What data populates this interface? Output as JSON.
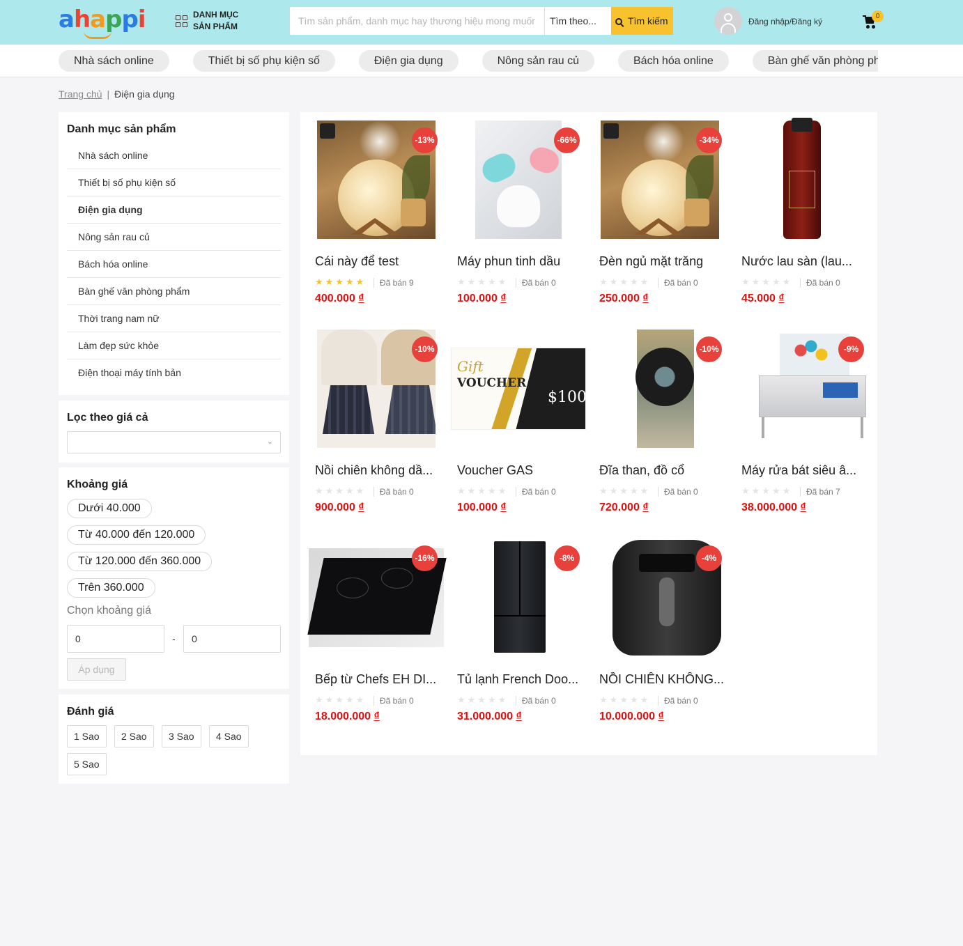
{
  "header": {
    "logo": [
      "a",
      "h",
      "a",
      "p",
      "p",
      "i"
    ],
    "logo_colors": [
      "#2a7be4",
      "#e94335",
      "#f29a1f",
      "#3aa655",
      "#2a7be4",
      "#e94335"
    ],
    "category_button": "DANH MỤC SẢN PHẨM",
    "search_placeholder": "Tìm sản phẩm, danh mục hay thương hiệu mong muốn",
    "search_scope": "Tìm theo...",
    "search_button": "Tìm kiếm",
    "login": "Đăng nhập/Đăng ký",
    "cart_count": "0"
  },
  "catnav": [
    "Nhà sách online",
    "Thiết bị số phụ kiện số",
    "Điện gia dụng",
    "Nông sản rau củ",
    "Bách hóa online",
    "Bàn ghế văn phòng phẩm"
  ],
  "breadcrumb": {
    "home": "Trang chủ",
    "sep": "|",
    "current": "Điện gia dụng"
  },
  "sidebar": {
    "categories_title": "Danh mục sản phẩm",
    "categories": [
      "Nhà sách online",
      "Thiết bị số phụ kiện số",
      "Điện gia dụng",
      "Nông sản rau củ",
      "Bách hóa online",
      "Bàn ghế văn phòng phẩm",
      "Thời trang nam nữ",
      "Làm đẹp sức khỏe",
      "Điện thoại máy tính bản"
    ],
    "active_category": 2,
    "price_filter_title": "Lọc theo giá cả",
    "range_title": "Khoảng giá",
    "ranges": [
      "Dưới 40.000",
      "Từ 40.000 đến 120.000",
      "Từ 120.000 đến 360.000",
      "Trên 360.000"
    ],
    "choose_range": "Chọn khoảng giá",
    "min": "0",
    "dash": "-",
    "max": "0",
    "apply": "Áp dụng",
    "rating_title": "Đánh giá",
    "ratings": [
      "1 Sao",
      "2 Sao",
      "3 Sao",
      "4 Sao",
      "5 Sao"
    ]
  },
  "products": [
    {
      "name": "Cái này để test",
      "discount": "-13%",
      "rating": 5,
      "sold": "Đã bán 9",
      "price": "400.000",
      "currency": "₫",
      "image": "moon-lamp"
    },
    {
      "name": "Máy phun tinh dầu",
      "discount": "-66%",
      "rating": 0,
      "sold": "Đã bán 0",
      "price": "100.000",
      "currency": "₫",
      "image": "mist-diffuser"
    },
    {
      "name": "Đèn ngủ mặt trăng",
      "discount": "-34%",
      "rating": 0,
      "sold": "Đã bán 0",
      "price": "250.000",
      "currency": "₫",
      "image": "moon-lamp"
    },
    {
      "name": "Nước lau sàn (lau...",
      "discount": "",
      "rating": 0,
      "sold": "Đã bán 0",
      "price": "45.000",
      "currency": "₫",
      "image": "cleaner-bottle"
    },
    {
      "name": "Nồi chiên không dầ...",
      "discount": "-10%",
      "rating": 0,
      "sold": "Đã bán 0",
      "price": "900.000",
      "currency": "₫",
      "image": "skirts"
    },
    {
      "name": "Voucher GAS",
      "discount": "",
      "rating": 0,
      "sold": "Đã bán 0",
      "price": "100.000",
      "currency": "₫",
      "image": "voucher",
      "voucher_text": [
        "Gift",
        "VOUCHER",
        "$100"
      ]
    },
    {
      "name": "Đĩa than, đồ cổ",
      "discount": "-10%",
      "rating": 0,
      "sold": "Đã bán 0",
      "price": "720.000",
      "currency": "₫",
      "image": "vinyl"
    },
    {
      "name": "Máy rửa bát siêu â...",
      "discount": "-9%",
      "rating": 0,
      "sold": "Đã bán 7",
      "price": "38.000.000",
      "currency": "₫",
      "image": "dishwasher"
    },
    {
      "name": "Bếp từ Chefs EH DI...",
      "discount": "-16%",
      "rating": 0,
      "sold": "Đã bán 0",
      "price": "18.000.000",
      "currency": "₫",
      "image": "induction-stove"
    },
    {
      "name": "Tủ lạnh French Doo...",
      "discount": "-8%",
      "rating": 0,
      "sold": "Đã bán 0",
      "price": "31.000.000",
      "currency": "₫",
      "image": "fridge"
    },
    {
      "name": "NỒI CHIÊN KHÔNG...",
      "discount": "-4%",
      "rating": 0,
      "sold": "Đã bán 0",
      "price": "10.000.000",
      "currency": "₫",
      "image": "air-fryer"
    }
  ]
}
